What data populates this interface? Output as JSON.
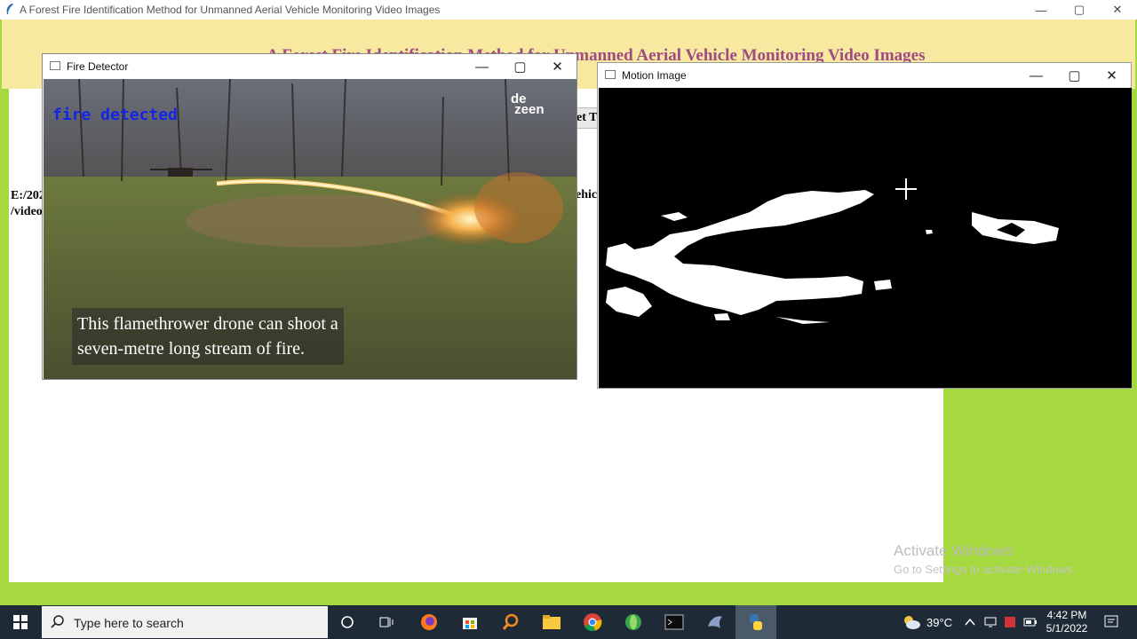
{
  "main_window": {
    "title": "A Forest Fire Identification Method for Unmanned Aerial Vehicle Monitoring Video Images",
    "heading": "A Forest Fire Identification Method for Unmanned Aerial Vehicle Monitoring Video Images",
    "path_text": "E:/202\n/video",
    "vehicle_fragment": "ehicl",
    "get_button_label": "et T",
    "controls": {
      "minimize": "—",
      "maximize": "▢",
      "close": "✕"
    }
  },
  "fire_window": {
    "title": "Fire Detector",
    "status": "fire detected",
    "logo": "de\nzeen",
    "caption_line1": "This flamethrower drone can shoot a",
    "caption_line2": "seven-metre long stream of fire."
  },
  "motion_window": {
    "title": "Motion Image"
  },
  "watermark": {
    "title": "Activate Windows",
    "subtitle": "Go to Settings to activate Windows."
  },
  "taskbar": {
    "search_placeholder": "Type here to search",
    "temperature": "39°C",
    "time": "4:42 PM",
    "date": "5/1/2022",
    "icons": [
      "windows-start-icon",
      "search-icon",
      "cortana-icon",
      "task-view-icon",
      "firefox-icon",
      "store-icon",
      "magnifier-app-icon",
      "file-explorer-icon",
      "chrome-icon",
      "green-app-icon",
      "terminal-icon",
      "dolphin-app-icon",
      "python-icon",
      "weather-icon",
      "chevron-up-icon",
      "speaker-icon",
      "battery-icon",
      "notification-icon"
    ]
  },
  "colors": {
    "background_green": "#a6d83f",
    "banner_yellow": "#f7e9a0",
    "heading_purple": "#a04a84",
    "status_blue": "#1525e6",
    "taskbar": "#1e2b36"
  }
}
